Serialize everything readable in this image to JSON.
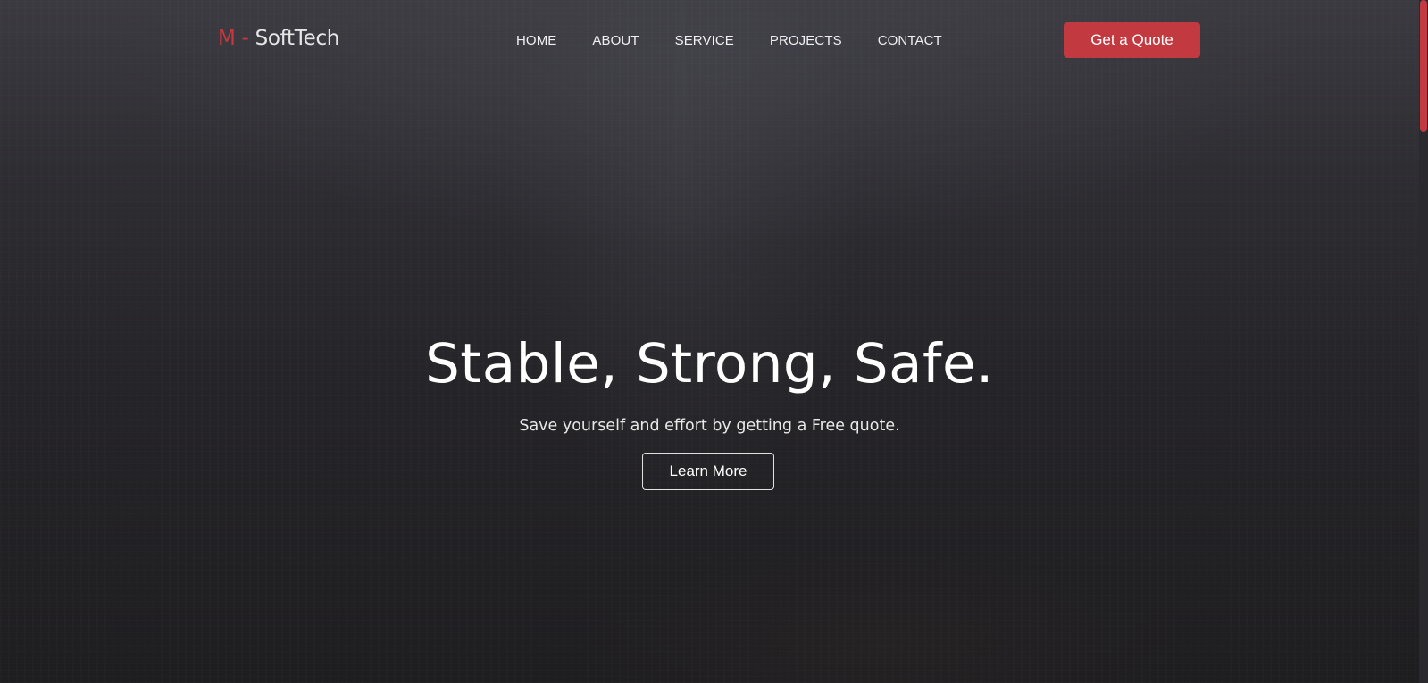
{
  "brand": {
    "prefix": "M -",
    "name": " SoftTech",
    "accent_color": "#c8363f"
  },
  "nav": {
    "items": [
      {
        "label": "HOME"
      },
      {
        "label": "ABOUT"
      },
      {
        "label": "SERVICE"
      },
      {
        "label": "PROJECTS"
      },
      {
        "label": "CONTACT"
      }
    ]
  },
  "header": {
    "cta_label": "Get a Quote",
    "cta_color": "#c23940"
  },
  "hero": {
    "headline": "Stable, Strong, Safe.",
    "subline": "Save yourself and effort by getting a Free quote.",
    "button_label": "Learn More"
  },
  "scrollbar": {
    "thumb_color": "#c23940"
  }
}
